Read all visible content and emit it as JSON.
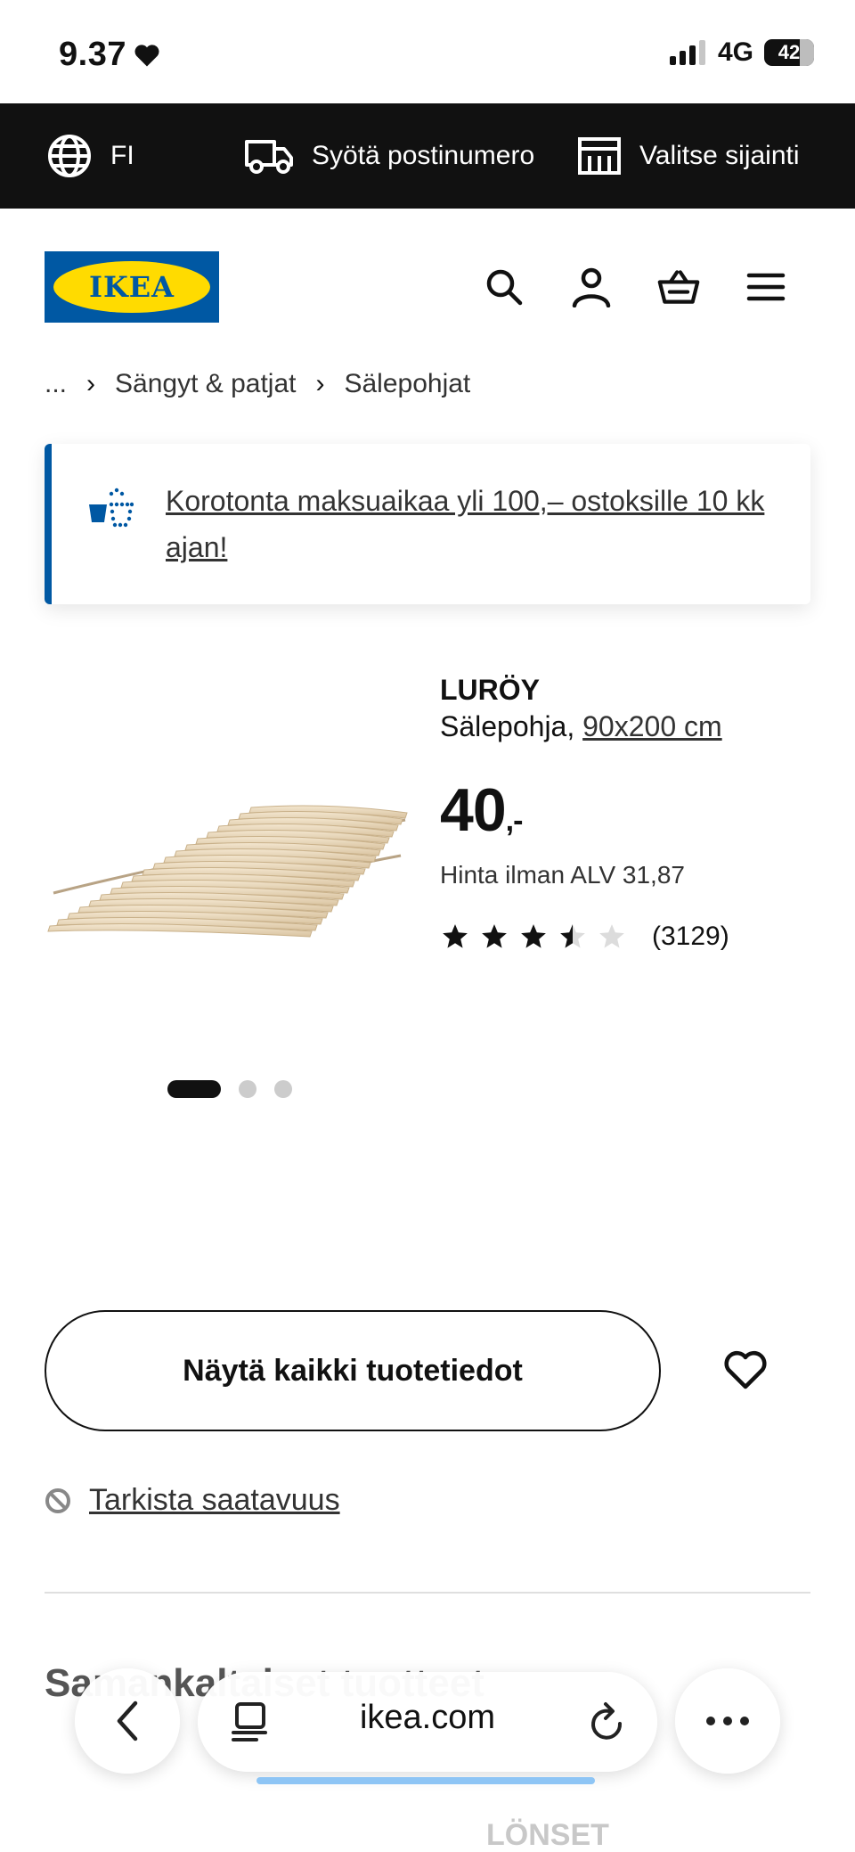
{
  "status_bar": {
    "time": "9.37",
    "network": "4G",
    "battery": "42"
  },
  "top_bar": {
    "language": "FI",
    "postcode": "Syötä postinumero",
    "store": "Valitse sijainti"
  },
  "header": {
    "logo_text": "IKEA",
    "icons": [
      "search-icon",
      "account-icon",
      "basket-icon",
      "menu-icon"
    ]
  },
  "breadcrumb": {
    "items": [
      "...",
      "Sängyt & patjat",
      "Sälepohjat"
    ]
  },
  "promo": {
    "text": "Korotonta maksuaikaa yli 100,– ostoksille 10 kk ajan!",
    "accent": "#0058a3"
  },
  "product": {
    "name": "LURÖY",
    "type": "Sälepohja,",
    "size": "90x200 cm",
    "price": "40",
    "price_suffix": ",-",
    "vat_text": "Hinta ilman ALV 31,87",
    "rating": 3.5,
    "rating_max": 5,
    "reviews": "(3129)",
    "image_count": 3,
    "image_active": 1
  },
  "actions": {
    "details_button": "Näytä kaikki tuotetiedot",
    "availability": "Tarkista saatavuus"
  },
  "section": {
    "title": "Samankaltaiset tuotteet",
    "peek": "LÖNSET"
  },
  "browser": {
    "url": "ikea.com"
  }
}
